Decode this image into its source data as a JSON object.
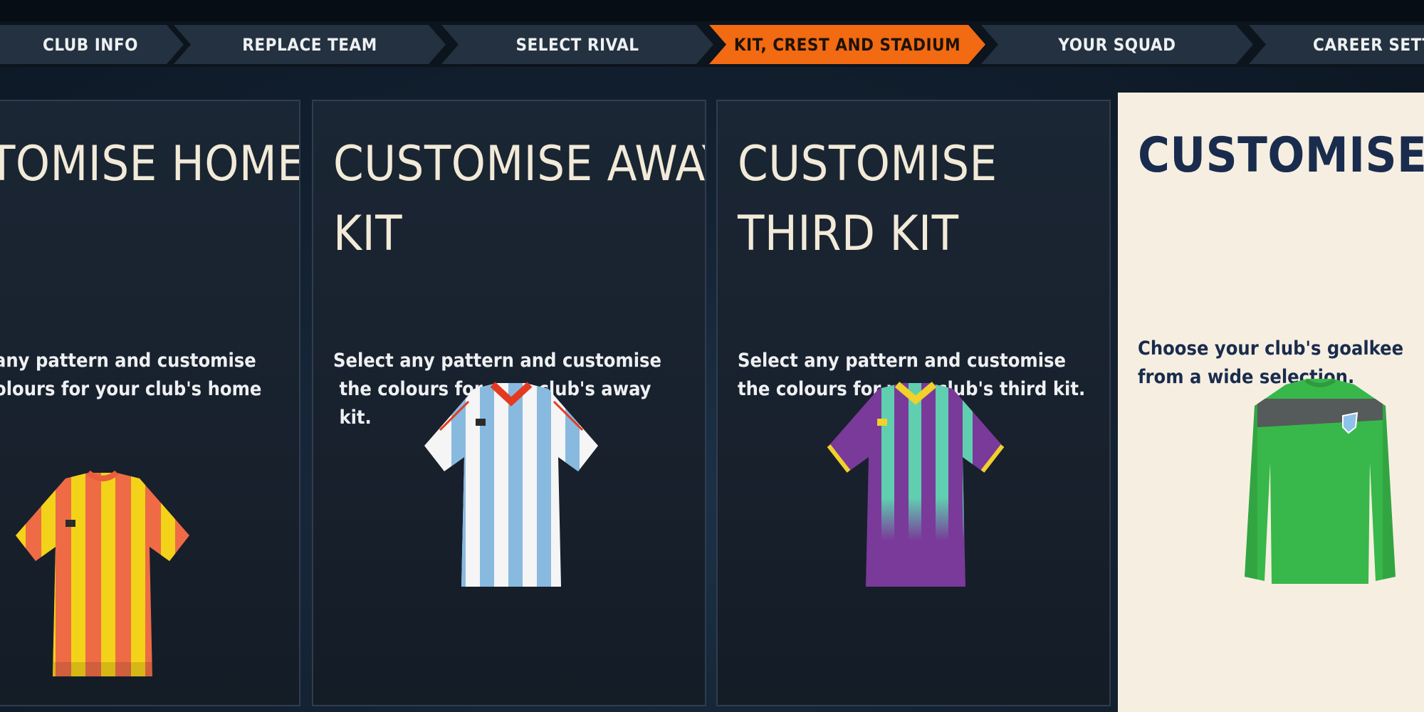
{
  "stepper": {
    "steps": [
      {
        "label": "CLUB INFO",
        "active": false
      },
      {
        "label": "REPLACE TEAM",
        "active": false
      },
      {
        "label": "SELECT RIVAL",
        "active": false
      },
      {
        "label": "KIT, CREST AND STADIUM",
        "active": true
      },
      {
        "label": "YOUR SQUAD",
        "active": false
      },
      {
        "label": "CAREER SETTIN",
        "active": false
      }
    ],
    "active_color": "#f26a12"
  },
  "cards": [
    {
      "title": "TOMISE HOME",
      "description_lines": [
        "any pattern and customise",
        "olours for your club's home"
      ],
      "kit_icon": "striped-shirt-icon",
      "colors": [
        "#ee6b46",
        "#f3d21a"
      ]
    },
    {
      "title": "CUSTOMISE AWAY KIT",
      "description_lines": [
        "Select any pattern and customise",
        "the colours for your club's away",
        "kit."
      ],
      "kit_icon": "striped-shirt-icon",
      "colors": [
        "#ffffff",
        "#8ec2ea",
        "#e43a22"
      ]
    },
    {
      "title": "CUSTOMISE THIRD KIT",
      "description_lines": [
        "Select any pattern and customise",
        "the colours for your club's third kit."
      ],
      "kit_icon": "striped-shirt-icon",
      "colors": [
        "#7a3a9a",
        "#5fcfb0",
        "#f1d12a"
      ]
    },
    {
      "title": "CUSTOMISE GK",
      "description_lines": [
        "Choose your club's goalkee",
        "from a wide selection."
      ],
      "kit_icon": "goalkeeper-shirt-icon",
      "colors": [
        "#38b84a",
        "#555a5a"
      ]
    }
  ]
}
